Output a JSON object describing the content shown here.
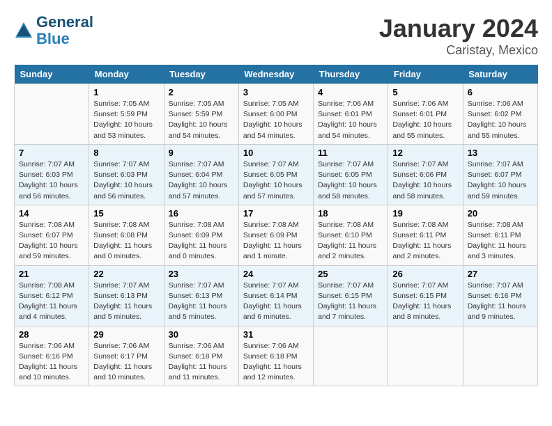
{
  "header": {
    "logo_line1": "General",
    "logo_line2": "Blue",
    "title": "January 2024",
    "subtitle": "Caristay, Mexico"
  },
  "weekdays": [
    "Sunday",
    "Monday",
    "Tuesday",
    "Wednesday",
    "Thursday",
    "Friday",
    "Saturday"
  ],
  "weeks": [
    [
      {
        "day": "",
        "info": ""
      },
      {
        "day": "1",
        "info": "Sunrise: 7:05 AM\nSunset: 5:59 PM\nDaylight: 10 hours\nand 53 minutes."
      },
      {
        "day": "2",
        "info": "Sunrise: 7:05 AM\nSunset: 5:59 PM\nDaylight: 10 hours\nand 54 minutes."
      },
      {
        "day": "3",
        "info": "Sunrise: 7:05 AM\nSunset: 6:00 PM\nDaylight: 10 hours\nand 54 minutes."
      },
      {
        "day": "4",
        "info": "Sunrise: 7:06 AM\nSunset: 6:01 PM\nDaylight: 10 hours\nand 54 minutes."
      },
      {
        "day": "5",
        "info": "Sunrise: 7:06 AM\nSunset: 6:01 PM\nDaylight: 10 hours\nand 55 minutes."
      },
      {
        "day": "6",
        "info": "Sunrise: 7:06 AM\nSunset: 6:02 PM\nDaylight: 10 hours\nand 55 minutes."
      }
    ],
    [
      {
        "day": "7",
        "info": "Sunrise: 7:07 AM\nSunset: 6:03 PM\nDaylight: 10 hours\nand 56 minutes."
      },
      {
        "day": "8",
        "info": "Sunrise: 7:07 AM\nSunset: 6:03 PM\nDaylight: 10 hours\nand 56 minutes."
      },
      {
        "day": "9",
        "info": "Sunrise: 7:07 AM\nSunset: 6:04 PM\nDaylight: 10 hours\nand 57 minutes."
      },
      {
        "day": "10",
        "info": "Sunrise: 7:07 AM\nSunset: 6:05 PM\nDaylight: 10 hours\nand 57 minutes."
      },
      {
        "day": "11",
        "info": "Sunrise: 7:07 AM\nSunset: 6:05 PM\nDaylight: 10 hours\nand 58 minutes."
      },
      {
        "day": "12",
        "info": "Sunrise: 7:07 AM\nSunset: 6:06 PM\nDaylight: 10 hours\nand 58 minutes."
      },
      {
        "day": "13",
        "info": "Sunrise: 7:07 AM\nSunset: 6:07 PM\nDaylight: 10 hours\nand 59 minutes."
      }
    ],
    [
      {
        "day": "14",
        "info": "Sunrise: 7:08 AM\nSunset: 6:07 PM\nDaylight: 10 hours\nand 59 minutes."
      },
      {
        "day": "15",
        "info": "Sunrise: 7:08 AM\nSunset: 6:08 PM\nDaylight: 11 hours\nand 0 minutes."
      },
      {
        "day": "16",
        "info": "Sunrise: 7:08 AM\nSunset: 6:09 PM\nDaylight: 11 hours\nand 0 minutes."
      },
      {
        "day": "17",
        "info": "Sunrise: 7:08 AM\nSunset: 6:09 PM\nDaylight: 11 hours\nand 1 minute."
      },
      {
        "day": "18",
        "info": "Sunrise: 7:08 AM\nSunset: 6:10 PM\nDaylight: 11 hours\nand 2 minutes."
      },
      {
        "day": "19",
        "info": "Sunrise: 7:08 AM\nSunset: 6:11 PM\nDaylight: 11 hours\nand 2 minutes."
      },
      {
        "day": "20",
        "info": "Sunrise: 7:08 AM\nSunset: 6:11 PM\nDaylight: 11 hours\nand 3 minutes."
      }
    ],
    [
      {
        "day": "21",
        "info": "Sunrise: 7:08 AM\nSunset: 6:12 PM\nDaylight: 11 hours\nand 4 minutes."
      },
      {
        "day": "22",
        "info": "Sunrise: 7:07 AM\nSunset: 6:13 PM\nDaylight: 11 hours\nand 5 minutes."
      },
      {
        "day": "23",
        "info": "Sunrise: 7:07 AM\nSunset: 6:13 PM\nDaylight: 11 hours\nand 5 minutes."
      },
      {
        "day": "24",
        "info": "Sunrise: 7:07 AM\nSunset: 6:14 PM\nDaylight: 11 hours\nand 6 minutes."
      },
      {
        "day": "25",
        "info": "Sunrise: 7:07 AM\nSunset: 6:15 PM\nDaylight: 11 hours\nand 7 minutes."
      },
      {
        "day": "26",
        "info": "Sunrise: 7:07 AM\nSunset: 6:15 PM\nDaylight: 11 hours\nand 8 minutes."
      },
      {
        "day": "27",
        "info": "Sunrise: 7:07 AM\nSunset: 6:16 PM\nDaylight: 11 hours\nand 9 minutes."
      }
    ],
    [
      {
        "day": "28",
        "info": "Sunrise: 7:06 AM\nSunset: 6:16 PM\nDaylight: 11 hours\nand 10 minutes."
      },
      {
        "day": "29",
        "info": "Sunrise: 7:06 AM\nSunset: 6:17 PM\nDaylight: 11 hours\nand 10 minutes."
      },
      {
        "day": "30",
        "info": "Sunrise: 7:06 AM\nSunset: 6:18 PM\nDaylight: 11 hours\nand 11 minutes."
      },
      {
        "day": "31",
        "info": "Sunrise: 7:06 AM\nSunset: 6:18 PM\nDaylight: 11 hours\nand 12 minutes."
      },
      {
        "day": "",
        "info": ""
      },
      {
        "day": "",
        "info": ""
      },
      {
        "day": "",
        "info": ""
      }
    ]
  ]
}
